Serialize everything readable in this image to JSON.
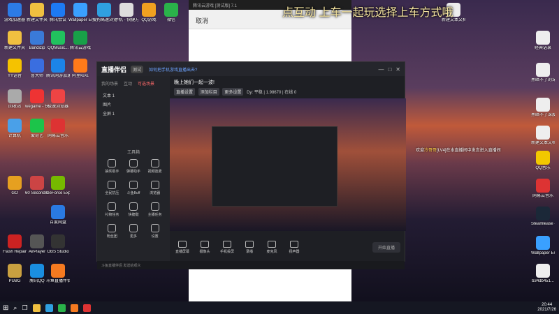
{
  "desktop": {
    "icons_left": [
      {
        "label": "游戏加速器",
        "color": "#2c7be5"
      },
      {
        "label": "新建文件夹",
        "color": "#f0c040"
      },
      {
        "label": "腾讯会议",
        "color": "#1d7af3"
      },
      {
        "label": "Wallpaper Engine",
        "color": "#3aa0ff"
      },
      {
        "label": "搜狗高速浏览器",
        "color": "#2fa0e0"
      },
      {
        "label": "手机 - 快捷方式",
        "color": "#ddd"
      },
      {
        "label": "QQ游戏",
        "color": "#f0a020"
      },
      {
        "label": "微信",
        "color": "#2ab34a"
      },
      {
        "label": "新建文件夹",
        "color": "#f0c040"
      },
      {
        "label": "Bandizip",
        "color": "#3a7ad8"
      },
      {
        "label": "QQMusic...",
        "color": "#21c25e"
      },
      {
        "label": "腾讯云游戏",
        "color": "#18a048"
      },
      {
        "label": "YY语音",
        "color": "#f5c200"
      },
      {
        "label": "鲁大师",
        "color": "#3a6ee0"
      },
      {
        "label": "腾讯网游加速器",
        "color": "#1c84e8"
      },
      {
        "label": "阿里旺旺",
        "color": "#ff7a1a"
      },
      {
        "label": "回收站",
        "color": "#aaa"
      },
      {
        "label": "wegame - 快捷方式",
        "color": "#e33"
      },
      {
        "label": "极速浏览器",
        "color": "#e44"
      },
      {
        "label": "计算机",
        "color": "#4aa0e8"
      },
      {
        "label": "爱奇艺",
        "color": "#1cc44a"
      },
      {
        "label": "网易云音乐",
        "color": "#d33"
      },
      {
        "label": "GO",
        "color": "#e6a020"
      },
      {
        "label": "60 Seconds! Reatomized",
        "color": "#c44"
      },
      {
        "label": "GeForce Experience",
        "color": "#76b900"
      },
      {
        "label": "百度网盘",
        "color": "#2a7ae2"
      },
      {
        "label": "Flash Repair",
        "color": "#c22"
      },
      {
        "label": "AirPlayer",
        "color": "#555"
      },
      {
        "label": "OBS Studio",
        "color": "#333"
      },
      {
        "label": "PUBG",
        "color": "#c9a040"
      },
      {
        "label": "腾讯QQ",
        "color": "#1a8ee0"
      },
      {
        "label": "斗鱼直播伴侣",
        "color": "#f57a20"
      }
    ],
    "icons_right": [
      {
        "label": "新建文本文档(3).txt",
        "color": "#eee"
      },
      {
        "label": "经典语录",
        "color": "#eee"
      },
      {
        "label": "黑暗不了的深度2.txt",
        "color": "#eee"
      },
      {
        "label": "黑暗不了深度2.txt",
        "color": "#eee"
      },
      {
        "label": "新建文本文档",
        "color": "#eee"
      },
      {
        "label": "QQ音乐",
        "color": "#f2c800"
      },
      {
        "label": "网易云音乐",
        "color": "#d33"
      },
      {
        "label": "Steamlease - 快捷方式",
        "color": "#1b2838"
      },
      {
        "label": "Wallpaper Engine",
        "color": "#3aa0ff"
      },
      {
        "label": "b34db451...",
        "color": "#eee"
      }
    ]
  },
  "overlay_title": "点互动 上车一起玩选择上车方式哦",
  "bg_window": {
    "title": "腾讯云游戏 [测试版] 7.1",
    "cancel_label": "取消"
  },
  "live_app": {
    "logo": "直播伴侣",
    "badge": "测试",
    "notice": "如何把手机游戏直播出去?",
    "tabs": [
      "我的场景",
      "互动",
      "可选场景"
    ],
    "scenes": [
      "文本 1",
      "图片",
      "全屏 1"
    ],
    "tools_title": "工具箱",
    "tools": [
      "抽奖助手",
      "弹幕助手",
      "视频连麦",
      "全民抗压",
      "斗鱼Buff",
      "浏览器",
      "礼物任务",
      "快捷键",
      "主播任务",
      "粉丝团",
      "更多",
      "设置"
    ],
    "room_name": "晚上她们一起一波!",
    "room_chips": [
      "直播设置",
      "添加栏目",
      "更多设置"
    ],
    "room_stats": "Dy: 平稳 | 1.98670 | 在线 0",
    "bottom_tools": [
      "直播屏幕",
      "摄像头",
      "手机投屏",
      "录播",
      "麦克风",
      "扬声器"
    ],
    "live_button": "开始直播",
    "status": "斗鱼直播伴侣 发送给观众"
  },
  "chat_message": {
    "prefix": "欢迎",
    "user": "冷哥哥",
    "suffix": "[LV4]在本直播间中发言进入直播间"
  },
  "taskbar": {
    "time": "20:44",
    "date": "2021/7/26"
  }
}
